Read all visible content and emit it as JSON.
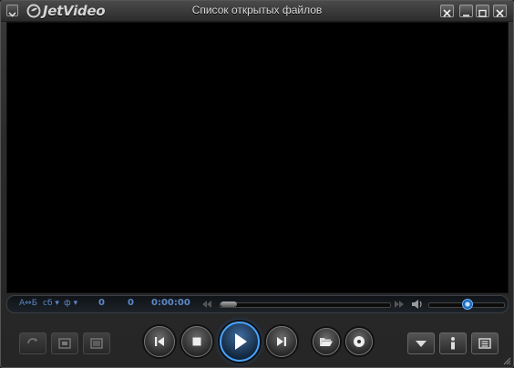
{
  "window": {
    "title": "Список открытых файлов",
    "brand": "JetVideo"
  },
  "status": {
    "subtitle_switch": "А⇔Б",
    "subtitle_menu": "сб",
    "audio_menu": "ф",
    "counter_a": "0",
    "counter_b": "0",
    "time": "0:00:00",
    "seek_progress": 0.0,
    "volume": 0.52
  },
  "colors": {
    "accent": "#4aa3ff",
    "status_text": "#5d88c8",
    "video_bg": "#000000"
  },
  "icons": {
    "system_menu": "system-menu-icon",
    "close": "close-icon",
    "minimize": "minimize-icon",
    "maximize": "maximize-icon",
    "volume": "speaker-icon",
    "prev": "previous-track-icon",
    "stop": "stop-icon",
    "play": "play-icon",
    "next": "next-track-icon",
    "open": "folder-open-icon",
    "disc": "disc-icon",
    "dropdown": "triangle-down-icon",
    "info": "info-icon",
    "playlist": "playlist-icon"
  }
}
